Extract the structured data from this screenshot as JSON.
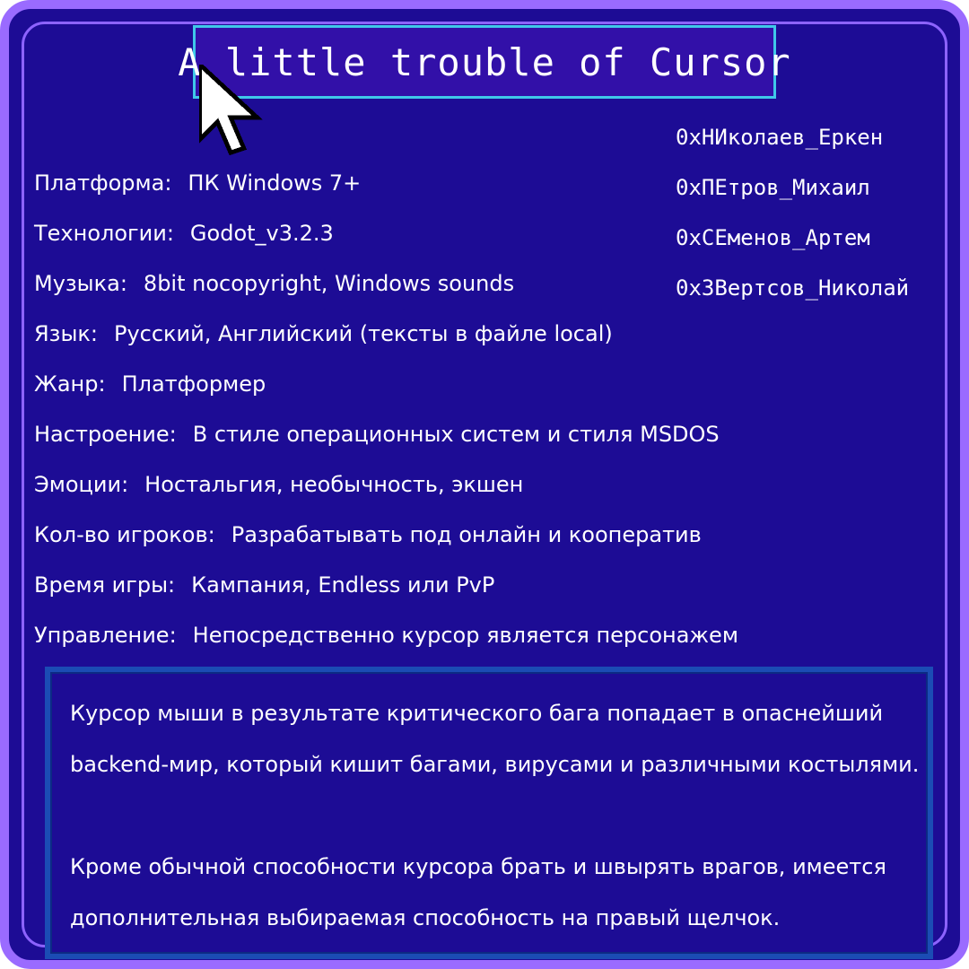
{
  "title": "A little trouble of Cursor",
  "team": [
    "0хНИколаев_Еркен",
    "0хПЕтров_Михаил",
    "0хСЕменов_Артем",
    "0хЗВертсов_Николай"
  ],
  "info": [
    {
      "label": "Платформа:",
      "value": "ПК Windows 7+"
    },
    {
      "label": "Технологии:",
      "value": "Godot_v3.2.3"
    },
    {
      "label": "Музыка:",
      "value": "8bit nocopyright, Windows sounds"
    },
    {
      "label": "Язык:",
      "value": "Русский, Английский (тексты в файле local)"
    },
    {
      "label": "Жанр:",
      "value": "Платформер"
    },
    {
      "label": "Настроение:",
      "value": "В стиле операционных систем и стиля MSDOS"
    },
    {
      "label": "Эмоции:",
      "value": "Ностальгия, необычность, экшен"
    },
    {
      "label": "Кол-во игроков:",
      "value": "Разрабатывать под онлайн и кооператив"
    },
    {
      "label": "Время игры:",
      "value": "Кампания, Endless или PvP"
    },
    {
      "label": "Управление:",
      "value": "Непосредственно курсор является персонажем"
    }
  ],
  "description": {
    "line1": "Курсор мыши в результате критического бага попадает в опаснейший",
    "line2": "backend-мир, который кишит багами, вирусами и различными костылями.",
    "line3": "Кроме обычной способности курсора брать и швырять врагов, имеется",
    "line4": "дополнительная выбираемая способность на правый щелчок."
  },
  "icons": {
    "cursor": "mouse-pointer-icon"
  },
  "colors": {
    "background": "#1d0c95",
    "outer_border": "#9a6bff",
    "title_border": "#3fc8e9",
    "description_border": "#1b4cb4",
    "text": "#ffffff"
  }
}
